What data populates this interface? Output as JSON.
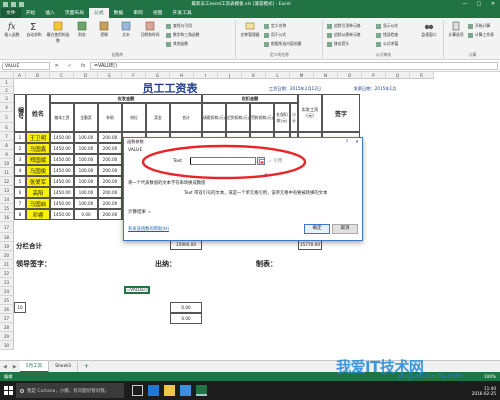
{
  "window": {
    "title": "最新员工excel工资表模板.xls [兼容模式] - Excel",
    "min": "—",
    "max": "□",
    "close": "✕"
  },
  "tabs": [
    "文件",
    "开始",
    "插入",
    "页面布局",
    "公式",
    "数据",
    "审阅",
    "视图",
    "开发工具"
  ],
  "ribbon": {
    "insert_function": "插入函数",
    "autosum": "自动求和",
    "recent": "最近使用的函数",
    "financial": "财务",
    "logical": "逻辑",
    "text": "文本",
    "datetime": "日期和时间",
    "lookup": "查找与引用",
    "math": "数学和三角函数",
    "more": "其他函数",
    "library_label": "函数库",
    "name_manager": "名称管理器",
    "define_name": "定义名称",
    "use_in_formula": "用于公式",
    "create_from_selection": "根据所选内容创建",
    "defined_names_label": "定义的名称",
    "trace_precedents": "追踪引用单元格",
    "trace_dependents": "追踪从属单元格",
    "remove_arrows": "移去箭头",
    "show_formulas": "显示公式",
    "error_checking": "错误检查",
    "evaluate_formula": "公式求值",
    "auditing_label": "公式审核",
    "watch_window": "监视窗口",
    "calc_options": "计算选项",
    "calc_now": "开始计算",
    "calc_sheet": "计算工作表",
    "calculation_label": "计算"
  },
  "formula_bar": {
    "name_box": "VALUE",
    "cancel": "✕",
    "enter": "✓",
    "fx": "fx",
    "content": "=VALUE()"
  },
  "columns": [
    "A",
    "B",
    "C",
    "D",
    "E",
    "F",
    "G",
    "H",
    "I",
    "J",
    "K",
    "L",
    "M",
    "N",
    "O",
    "P",
    "Q",
    "R"
  ],
  "rows": [
    "1",
    "2",
    "3",
    "4",
    "5",
    "6",
    "7",
    "8",
    "9",
    "10",
    "11",
    "12",
    "13",
    "14",
    "15",
    "16",
    "17",
    "18",
    "19",
    "20",
    "21",
    "22",
    "23",
    "24",
    "25",
    "26",
    "27",
    "28",
    "29",
    "30"
  ],
  "sheet": {
    "title": "员工工资表",
    "date_label": "工资日期：2015年2月12日",
    "pay_date": "发薪日期：2015年1月",
    "hdr_num": "编号",
    "hdr_name": "姓名",
    "hdr_payable": "应发金额",
    "hdr_deduct": "应扣金额",
    "hdr_actual": "实发工资(元)",
    "hdr_sign": "签字",
    "sub_headers": [
      "基本工资",
      "全勤奖",
      "补助",
      "岗位",
      "奖金",
      "合计",
      "请假扣款(元)",
      "迟到扣款(元)",
      "罚款扣款(元)",
      "社保扣款(元)",
      "小计"
    ],
    "employees": [
      {
        "no": "1",
        "name": "王卫明",
        "base": "1450.00",
        "full": "100.00",
        "sub": "200.00"
      },
      {
        "no": "2",
        "name": "马国鑫",
        "base": "1450.00",
        "full": "100.00",
        "sub": "200.00"
      },
      {
        "no": "3",
        "name": "郑国斌",
        "base": "1450.00",
        "full": "100.00",
        "sub": "200.00"
      },
      {
        "no": "4",
        "name": "马国俊",
        "base": "1450.00",
        "full": "100.00",
        "sub": "200.00"
      },
      {
        "no": "5",
        "name": "张爱军",
        "base": "1450.00",
        "full": "100.00",
        "sub": "200.00"
      },
      {
        "no": "6",
        "name": "高阳",
        "base": "1450.00",
        "full": "100.00",
        "sub": "200.00"
      },
      {
        "no": "7",
        "name": "马国启",
        "base": "1450.00",
        "full": "100.00",
        "sub": "200.00"
      },
      {
        "no": "8",
        "name": "邓睿",
        "base": "1450.00",
        "full": "0.00",
        "sub": "200.00"
      }
    ],
    "row10_total": "0.00",
    "row11_total": "0.00",
    "subtotal_label": "分栏合计",
    "subtotal_value": "15900.00",
    "subtotal_actual": "15770.00",
    "leader_sign": "领导签字：",
    "cashier": "出纳：",
    "preparer": "制表：",
    "active_cell": "=VALUE()"
  },
  "dialog": {
    "title": "函数参数",
    "help": "?",
    "close": "✕",
    "func_name": "VALUE",
    "arg_label": "Text",
    "arg_value": "",
    "arg_result": "= 引用",
    "equals": "=",
    "description": "将一个代表数值的文本字符串转换成数值",
    "arg_description": "Text  带双引号的文本，或是一个单元格引用，该单元格中有要被转换的文本",
    "result_label": "计算结果 =",
    "help_link": "有关该函数的帮助(H)",
    "ok": "确定",
    "cancel": "取消"
  },
  "sheet_tabs": [
    "5月工资",
    "Sheet3"
  ],
  "add_sheet": "+",
  "status": {
    "mode": "编辑",
    "zoom": "100%"
  },
  "taskbar": {
    "search_placeholder": "我是 Cortana，小娜。有问题尽管问我。",
    "time": "11:40",
    "date": "2016-02-25"
  },
  "watermark": {
    "main": "我爱IT技术网",
    "sub": "jingyan.baidu.com"
  },
  "colors": {
    "excel_green": "#217346",
    "highlight_red": "#e8262a",
    "title_blue": "#1f3c88",
    "yellow": "#fff200"
  }
}
